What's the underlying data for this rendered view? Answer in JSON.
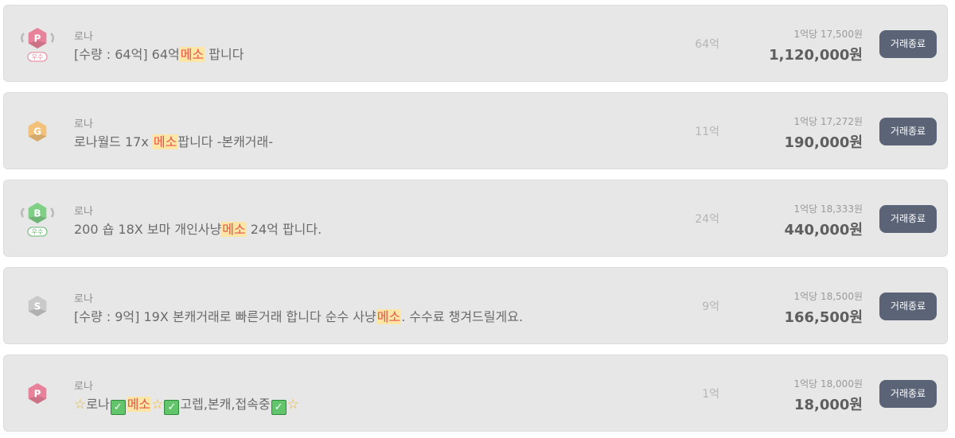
{
  "listings": [
    {
      "badge": {
        "icon": "pink-p-excellent-badge-icon",
        "letter": "P",
        "tier": "우수",
        "color": "#e8829a",
        "tierColor": "#e8829a"
      },
      "server": "로나",
      "title_parts": [
        {
          "type": "text",
          "text": "[수량 : 64억] 64억"
        },
        {
          "type": "hl",
          "text": "메소"
        },
        {
          "type": "text",
          "text": " 팝니다"
        }
      ],
      "quantity": "64억",
      "unit_price": "1억당 17,500원",
      "price": "1,120,000원",
      "button": "거래종료"
    },
    {
      "badge": {
        "icon": "gold-g-badge-icon",
        "letter": "G",
        "tier": "",
        "color": "#f3c27a",
        "tierColor": ""
      },
      "server": "로나",
      "title_parts": [
        {
          "type": "text",
          "text": "로나월드 17x "
        },
        {
          "type": "hl",
          "text": "메소"
        },
        {
          "type": "text",
          "text": "팝니다 -본캐거래-"
        }
      ],
      "quantity": "11억",
      "unit_price": "1억당 17,272원",
      "price": "190,000원",
      "button": "거래종료"
    },
    {
      "badge": {
        "icon": "green-b-excellent-badge-icon",
        "letter": "B",
        "tier": "우수",
        "color": "#7fcf86",
        "tierColor": "#6ab872"
      },
      "server": "로나",
      "title_parts": [
        {
          "type": "text",
          "text": "200 숍 18X 보마 개인사냥"
        },
        {
          "type": "hl",
          "text": "메소"
        },
        {
          "type": "text",
          "text": " 24억 팝니다."
        }
      ],
      "quantity": "24억",
      "unit_price": "1억당 18,333원",
      "price": "440,000원",
      "button": "거래종료"
    },
    {
      "badge": {
        "icon": "silver-s-badge-icon",
        "letter": "S",
        "tier": "",
        "color": "#c9c9c9",
        "tierColor": ""
      },
      "server": "로나",
      "title_parts": [
        {
          "type": "text",
          "text": "[수량 : 9억] 19X 본캐거래로 빠른거래 합니다 순수 사냥"
        },
        {
          "type": "hl",
          "text": "메소"
        },
        {
          "type": "text",
          "text": ". 수수료 챙겨드릴게요."
        }
      ],
      "quantity": "9억",
      "unit_price": "1억당 18,500원",
      "price": "166,500원",
      "button": "거래종료"
    },
    {
      "badge": {
        "icon": "pink-p-badge-icon",
        "letter": "P",
        "tier": "",
        "color": "#e8829a",
        "tierColor": ""
      },
      "server": "로나",
      "title_parts": [
        {
          "type": "star",
          "text": "☆"
        },
        {
          "type": "text",
          "text": "로나"
        },
        {
          "type": "check",
          "text": "✓"
        },
        {
          "type": "hl",
          "text": "메소"
        },
        {
          "type": "star",
          "text": "☆"
        },
        {
          "type": "check",
          "text": "✓"
        },
        {
          "type": "text",
          "text": "고렙,본캐,접속중"
        },
        {
          "type": "check",
          "text": "✓"
        },
        {
          "type": "star",
          "text": "☆"
        }
      ],
      "quantity": "1억",
      "unit_price": "1억당 18,000원",
      "price": "18,000원",
      "button": "거래종료"
    }
  ]
}
